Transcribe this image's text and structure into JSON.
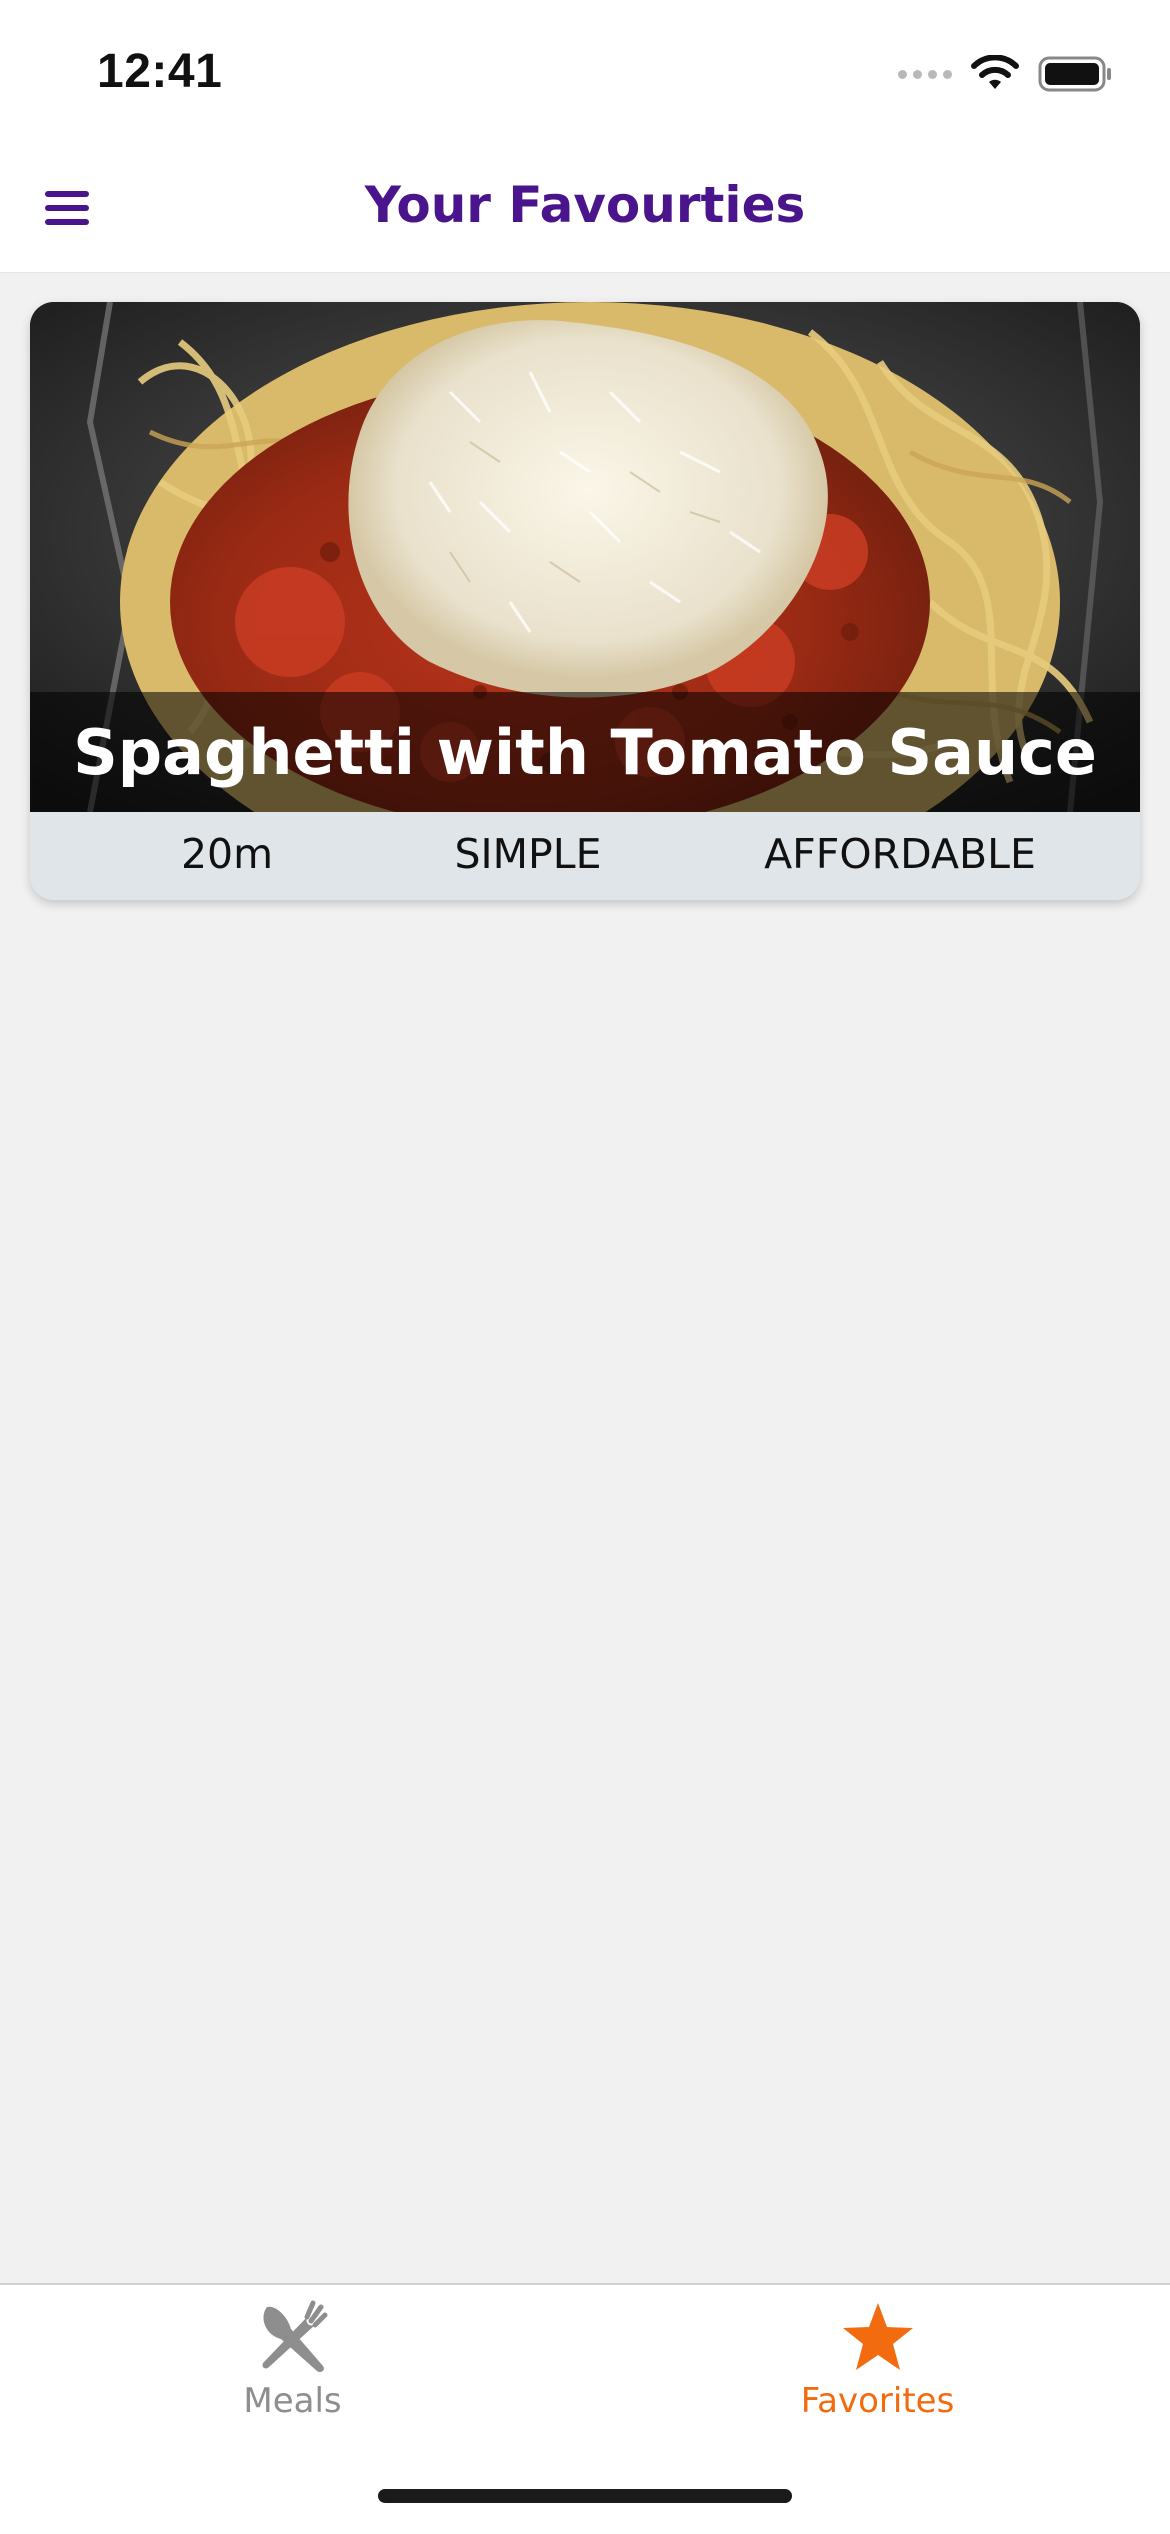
{
  "status_bar": {
    "time": "12:41"
  },
  "header": {
    "title": "Your Favourties",
    "title_color": "#4a148c"
  },
  "favorites": [
    {
      "title": "Spaghetti with Tomato Sauce",
      "duration": "20m",
      "complexity": "SIMPLE",
      "affordability": "AFFORDABLE",
      "image_icon": "spaghetti-photo"
    }
  ],
  "tabs": [
    {
      "label": "Meals",
      "icon": "fork-knife-icon",
      "active": false,
      "color": "#8e8e8e"
    },
    {
      "label": "Favorites",
      "icon": "star-icon",
      "active": true,
      "color": "#f26b0f"
    }
  ]
}
